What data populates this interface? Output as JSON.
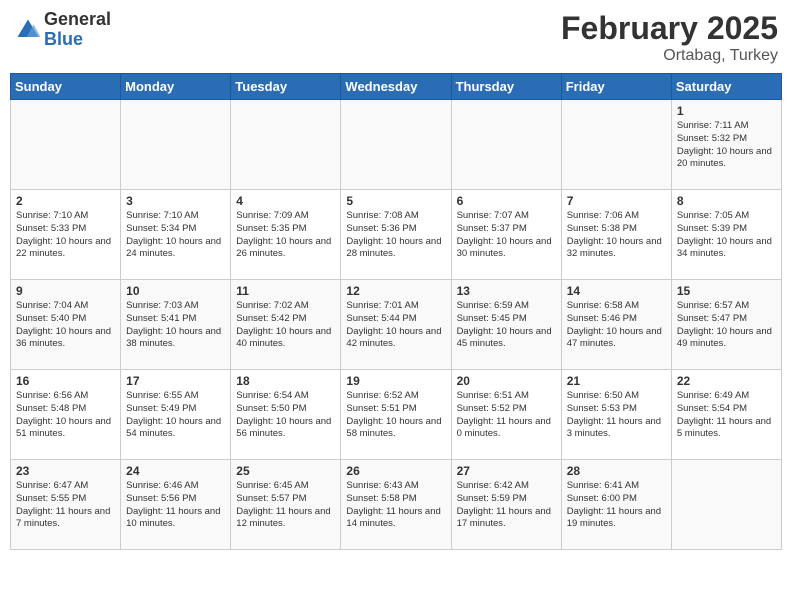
{
  "header": {
    "logo_general": "General",
    "logo_blue": "Blue",
    "month": "February 2025",
    "location": "Ortabag, Turkey"
  },
  "days_of_week": [
    "Sunday",
    "Monday",
    "Tuesday",
    "Wednesday",
    "Thursday",
    "Friday",
    "Saturday"
  ],
  "weeks": [
    [
      {
        "day": "",
        "info": ""
      },
      {
        "day": "",
        "info": ""
      },
      {
        "day": "",
        "info": ""
      },
      {
        "day": "",
        "info": ""
      },
      {
        "day": "",
        "info": ""
      },
      {
        "day": "",
        "info": ""
      },
      {
        "day": "1",
        "info": "Sunrise: 7:11 AM\nSunset: 5:32 PM\nDaylight: 10 hours and 20 minutes."
      }
    ],
    [
      {
        "day": "2",
        "info": "Sunrise: 7:10 AM\nSunset: 5:33 PM\nDaylight: 10 hours and 22 minutes."
      },
      {
        "day": "3",
        "info": "Sunrise: 7:10 AM\nSunset: 5:34 PM\nDaylight: 10 hours and 24 minutes."
      },
      {
        "day": "4",
        "info": "Sunrise: 7:09 AM\nSunset: 5:35 PM\nDaylight: 10 hours and 26 minutes."
      },
      {
        "day": "5",
        "info": "Sunrise: 7:08 AM\nSunset: 5:36 PM\nDaylight: 10 hours and 28 minutes."
      },
      {
        "day": "6",
        "info": "Sunrise: 7:07 AM\nSunset: 5:37 PM\nDaylight: 10 hours and 30 minutes."
      },
      {
        "day": "7",
        "info": "Sunrise: 7:06 AM\nSunset: 5:38 PM\nDaylight: 10 hours and 32 minutes."
      },
      {
        "day": "8",
        "info": "Sunrise: 7:05 AM\nSunset: 5:39 PM\nDaylight: 10 hours and 34 minutes."
      }
    ],
    [
      {
        "day": "9",
        "info": "Sunrise: 7:04 AM\nSunset: 5:40 PM\nDaylight: 10 hours and 36 minutes."
      },
      {
        "day": "10",
        "info": "Sunrise: 7:03 AM\nSunset: 5:41 PM\nDaylight: 10 hours and 38 minutes."
      },
      {
        "day": "11",
        "info": "Sunrise: 7:02 AM\nSunset: 5:42 PM\nDaylight: 10 hours and 40 minutes."
      },
      {
        "day": "12",
        "info": "Sunrise: 7:01 AM\nSunset: 5:44 PM\nDaylight: 10 hours and 42 minutes."
      },
      {
        "day": "13",
        "info": "Sunrise: 6:59 AM\nSunset: 5:45 PM\nDaylight: 10 hours and 45 minutes."
      },
      {
        "day": "14",
        "info": "Sunrise: 6:58 AM\nSunset: 5:46 PM\nDaylight: 10 hours and 47 minutes."
      },
      {
        "day": "15",
        "info": "Sunrise: 6:57 AM\nSunset: 5:47 PM\nDaylight: 10 hours and 49 minutes."
      }
    ],
    [
      {
        "day": "16",
        "info": "Sunrise: 6:56 AM\nSunset: 5:48 PM\nDaylight: 10 hours and 51 minutes."
      },
      {
        "day": "17",
        "info": "Sunrise: 6:55 AM\nSunset: 5:49 PM\nDaylight: 10 hours and 54 minutes."
      },
      {
        "day": "18",
        "info": "Sunrise: 6:54 AM\nSunset: 5:50 PM\nDaylight: 10 hours and 56 minutes."
      },
      {
        "day": "19",
        "info": "Sunrise: 6:52 AM\nSunset: 5:51 PM\nDaylight: 10 hours and 58 minutes."
      },
      {
        "day": "20",
        "info": "Sunrise: 6:51 AM\nSunset: 5:52 PM\nDaylight: 11 hours and 0 minutes."
      },
      {
        "day": "21",
        "info": "Sunrise: 6:50 AM\nSunset: 5:53 PM\nDaylight: 11 hours and 3 minutes."
      },
      {
        "day": "22",
        "info": "Sunrise: 6:49 AM\nSunset: 5:54 PM\nDaylight: 11 hours and 5 minutes."
      }
    ],
    [
      {
        "day": "23",
        "info": "Sunrise: 6:47 AM\nSunset: 5:55 PM\nDaylight: 11 hours and 7 minutes."
      },
      {
        "day": "24",
        "info": "Sunrise: 6:46 AM\nSunset: 5:56 PM\nDaylight: 11 hours and 10 minutes."
      },
      {
        "day": "25",
        "info": "Sunrise: 6:45 AM\nSunset: 5:57 PM\nDaylight: 11 hours and 12 minutes."
      },
      {
        "day": "26",
        "info": "Sunrise: 6:43 AM\nSunset: 5:58 PM\nDaylight: 11 hours and 14 minutes."
      },
      {
        "day": "27",
        "info": "Sunrise: 6:42 AM\nSunset: 5:59 PM\nDaylight: 11 hours and 17 minutes."
      },
      {
        "day": "28",
        "info": "Sunrise: 6:41 AM\nSunset: 6:00 PM\nDaylight: 11 hours and 19 minutes."
      },
      {
        "day": "",
        "info": ""
      }
    ]
  ]
}
